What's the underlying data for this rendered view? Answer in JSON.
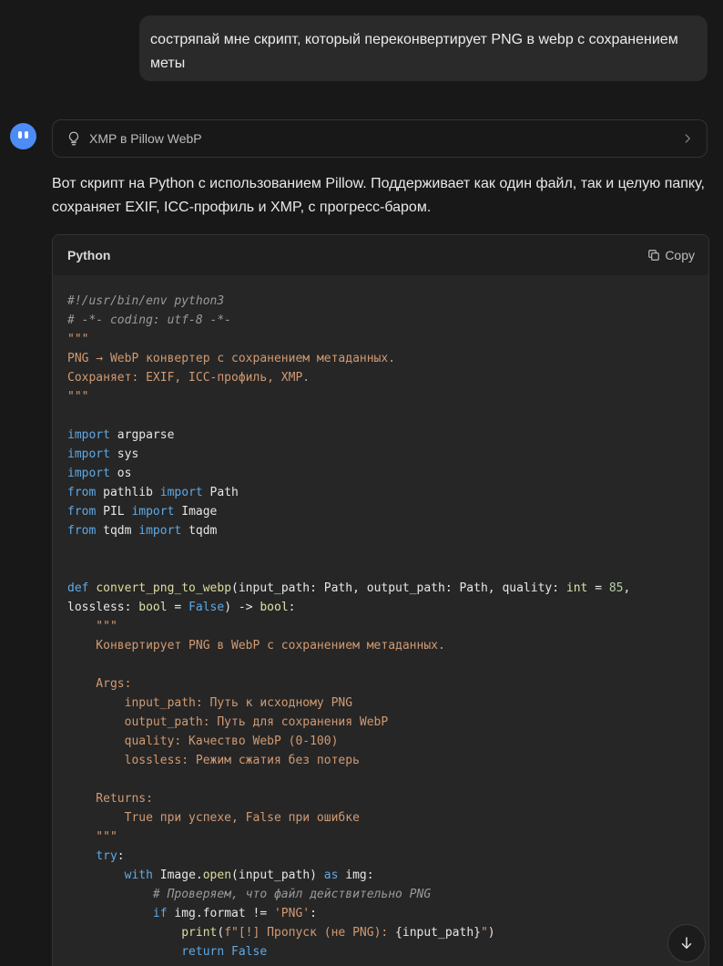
{
  "user_message": {
    "text": "состряпай мне скрипт, который переконвертирует PNG в webp с сохранением меты"
  },
  "thinking": {
    "label": "XMP в Pillow WebP",
    "icon": "lightbulb-icon"
  },
  "reply": {
    "text": "Вот скрипт на Python с использованием Pillow. Поддерживает как один файл, так и целую папку, сохраняет EXIF, ICC-профиль и XMP, с прогресс-баром."
  },
  "code_block": {
    "language": "Python",
    "copy_label": "Copy",
    "lines": [
      [
        {
          "t": "#!/usr/bin/env python3",
          "c": "comment"
        }
      ],
      [
        {
          "t": "# -*- coding: utf-8 -*-",
          "c": "comment"
        }
      ],
      [
        {
          "t": "\"\"\"",
          "c": "string"
        }
      ],
      [
        {
          "t": "PNG → WebP конвертер с сохранением метаданных.",
          "c": "string"
        }
      ],
      [
        {
          "t": "Сохраняет: EXIF, ICC-профиль, XMP.",
          "c": "string"
        }
      ],
      [
        {
          "t": "\"\"\"",
          "c": "string"
        }
      ],
      [],
      [
        {
          "t": "import",
          "c": "keyword"
        },
        {
          "t": " argparse",
          "c": "plain"
        }
      ],
      [
        {
          "t": "import",
          "c": "keyword"
        },
        {
          "t": " sys",
          "c": "plain"
        }
      ],
      [
        {
          "t": "import",
          "c": "keyword"
        },
        {
          "t": " os",
          "c": "plain"
        }
      ],
      [
        {
          "t": "from",
          "c": "keyword"
        },
        {
          "t": " pathlib ",
          "c": "plain"
        },
        {
          "t": "import",
          "c": "keyword"
        },
        {
          "t": " Path",
          "c": "plain"
        }
      ],
      [
        {
          "t": "from",
          "c": "keyword"
        },
        {
          "t": " PIL ",
          "c": "plain"
        },
        {
          "t": "import",
          "c": "keyword"
        },
        {
          "t": " Image",
          "c": "plain"
        }
      ],
      [
        {
          "t": "from",
          "c": "keyword"
        },
        {
          "t": " tqdm ",
          "c": "plain"
        },
        {
          "t": "import",
          "c": "keyword"
        },
        {
          "t": " tqdm",
          "c": "plain"
        }
      ],
      [],
      [],
      [
        {
          "t": "def",
          "c": "keyword"
        },
        {
          "t": " ",
          "c": "plain"
        },
        {
          "t": "convert_png_to_webp",
          "c": "func"
        },
        {
          "t": "(input_path: Path, output_path: Path, quality: ",
          "c": "plain"
        },
        {
          "t": "int",
          "c": "builtin"
        },
        {
          "t": " = ",
          "c": "plain"
        },
        {
          "t": "85",
          "c": "number"
        },
        {
          "t": ",",
          "c": "plain"
        }
      ],
      [
        {
          "t": "lossless: ",
          "c": "plain"
        },
        {
          "t": "bool",
          "c": "builtin"
        },
        {
          "t": " = ",
          "c": "plain"
        },
        {
          "t": "False",
          "c": "keyword"
        },
        {
          "t": ") -> ",
          "c": "plain"
        },
        {
          "t": "bool",
          "c": "builtin"
        },
        {
          "t": ":",
          "c": "plain"
        }
      ],
      [
        {
          "t": "    \"\"\"",
          "c": "string"
        }
      ],
      [
        {
          "t": "    Конвертирует PNG в WebP с сохранением метаданных.",
          "c": "string"
        }
      ],
      [],
      [
        {
          "t": "    Args:",
          "c": "string"
        }
      ],
      [
        {
          "t": "        input_path: Путь к исходному PNG",
          "c": "string"
        }
      ],
      [
        {
          "t": "        output_path: Путь для сохранения WebP",
          "c": "string"
        }
      ],
      [
        {
          "t": "        quality: Качество WebP (0-100)",
          "c": "string"
        }
      ],
      [
        {
          "t": "        lossless: Режим сжатия без потерь",
          "c": "string"
        }
      ],
      [],
      [
        {
          "t": "    Returns:",
          "c": "string"
        }
      ],
      [
        {
          "t": "        True при успехе, False при ошибке",
          "c": "string"
        }
      ],
      [
        {
          "t": "    \"\"\"",
          "c": "string"
        }
      ],
      [
        {
          "t": "    ",
          "c": "plain"
        },
        {
          "t": "try",
          "c": "keyword"
        },
        {
          "t": ":",
          "c": "plain"
        }
      ],
      [
        {
          "t": "        ",
          "c": "plain"
        },
        {
          "t": "with",
          "c": "keyword"
        },
        {
          "t": " Image.",
          "c": "plain"
        },
        {
          "t": "open",
          "c": "func"
        },
        {
          "t": "(input_path) ",
          "c": "plain"
        },
        {
          "t": "as",
          "c": "keyword"
        },
        {
          "t": " img:",
          "c": "plain"
        }
      ],
      [
        {
          "t": "            # Проверяем, что файл действительно PNG",
          "c": "comment"
        }
      ],
      [
        {
          "t": "            ",
          "c": "plain"
        },
        {
          "t": "if",
          "c": "keyword"
        },
        {
          "t": " img.format != ",
          "c": "plain"
        },
        {
          "t": "'PNG'",
          "c": "string"
        },
        {
          "t": ":",
          "c": "plain"
        }
      ],
      [
        {
          "t": "                ",
          "c": "plain"
        },
        {
          "t": "print",
          "c": "func"
        },
        {
          "t": "(",
          "c": "plain"
        },
        {
          "t": "f\"[!] Пропуск (не PNG): ",
          "c": "string"
        },
        {
          "t": "{input_path}",
          "c": "plain"
        },
        {
          "t": "\"",
          "c": "string"
        },
        {
          "t": ")",
          "c": "plain"
        }
      ],
      [
        {
          "t": "                ",
          "c": "plain"
        },
        {
          "t": "return",
          "c": "keyword"
        },
        {
          "t": " ",
          "c": "plain"
        },
        {
          "t": "False",
          "c": "keyword"
        }
      ]
    ]
  },
  "scroll_button": {
    "icon": "arrow-down-icon"
  }
}
